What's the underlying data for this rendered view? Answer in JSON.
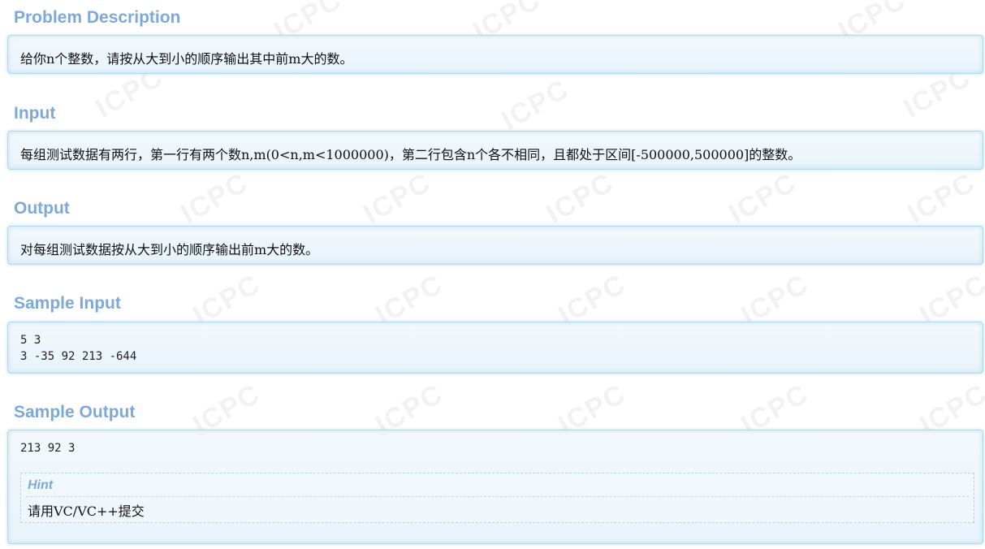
{
  "watermark": {
    "text": "ICPC"
  },
  "problem_description": {
    "title": "Problem Description",
    "text": "给你n个整数，请按从大到小的顺序输出其中前m大的数。"
  },
  "input": {
    "title": "Input",
    "text": "每组测试数据有两行，第一行有两个数n,m(0<n,m<1000000)，第二行包含n个各不相同，且都处于区间[-500000,500000]的整数。"
  },
  "output": {
    "title": "Output",
    "text": "对每组测试数据按从大到小的顺序输出前m大的数。"
  },
  "sample_input": {
    "title": "Sample Input",
    "lines": [
      "5 3",
      "3 -35 92 213 -644"
    ]
  },
  "sample_output": {
    "title": "Sample Output",
    "lines": [
      "213 92 3"
    ]
  },
  "hint": {
    "title": "Hint",
    "text": "请用VC/VC++提交"
  },
  "colors": {
    "section_title": "#7ca9d9",
    "panel_border": "#aedbf0",
    "panel_bg": "#eaf5fc"
  }
}
